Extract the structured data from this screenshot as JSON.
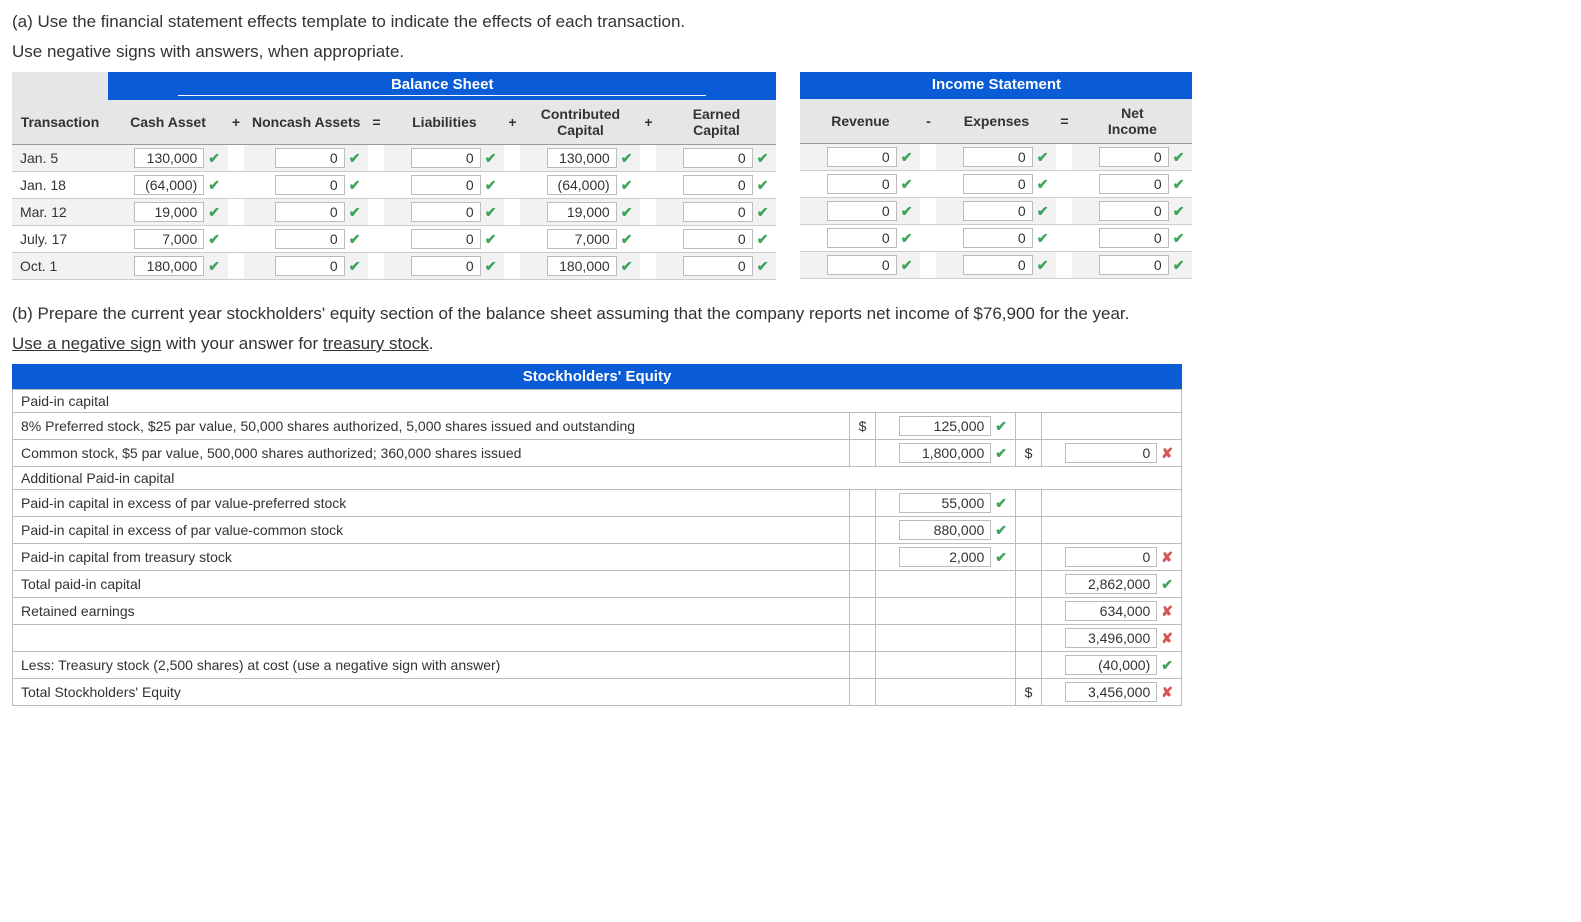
{
  "partA": {
    "prompt": "(a) Use the financial statement effects template to indicate the effects of each transaction.",
    "subprompt": "Use negative signs with answers, when appropriate.",
    "balanceSheetTitle": "Balance Sheet",
    "incomeStatementTitle": "Income Statement",
    "headers": {
      "transaction": "Transaction",
      "cash": "Cash Asset",
      "noncash": "Noncash Assets",
      "liab": "Liabilities",
      "contrib_top": "Contributed",
      "contrib_bot": "Capital",
      "earned_top": "Earned",
      "earned_bot": "Capital",
      "rev": "Revenue",
      "exp": "Expenses",
      "net_top": "Net",
      "net_bot": "Income"
    },
    "rows": [
      {
        "date": "Jan. 5",
        "cash": "130,000",
        "noncash": "0",
        "liab": "0",
        "contrib": "130,000",
        "earned": "0",
        "rev": "0",
        "exp": "0",
        "net": "0"
      },
      {
        "date": "Jan. 18",
        "cash": "(64,000)",
        "noncash": "0",
        "liab": "0",
        "contrib": "(64,000)",
        "earned": "0",
        "rev": "0",
        "exp": "0",
        "net": "0"
      },
      {
        "date": "Mar. 12",
        "cash": "19,000",
        "noncash": "0",
        "liab": "0",
        "contrib": "19,000",
        "earned": "0",
        "rev": "0",
        "exp": "0",
        "net": "0"
      },
      {
        "date": "July. 17",
        "cash": "7,000",
        "noncash": "0",
        "liab": "0",
        "contrib": "7,000",
        "earned": "0",
        "rev": "0",
        "exp": "0",
        "net": "0"
      },
      {
        "date": "Oct. 1",
        "cash": "180,000",
        "noncash": "0",
        "liab": "0",
        "contrib": "180,000",
        "earned": "0",
        "rev": "0",
        "exp": "0",
        "net": "0"
      }
    ]
  },
  "partB": {
    "prompt_pre": "(b) Prepare the current year stockholders' equity section of the balance sheet assuming that the company reports net income of $76,900 for the year.",
    "prompt_hint_a": "Use a negative sign",
    "prompt_hint_mid": " with your answer for ",
    "prompt_hint_b": "treasury stock",
    "title": "Stockholders' Equity",
    "rows": {
      "pic": "Paid-in capital",
      "pref": "8% Preferred stock, $25 par value, 50,000 shares authorized, 5,000 shares issued and outstanding",
      "common": "Common stock, $5 par value, 500,000 shares authorized; 360,000 shares issued",
      "apic": "Additional Paid-in capital",
      "pic_pref": "Paid-in capital in excess of par value-preferred stock",
      "pic_com": "Paid-in capital in excess of par value-common stock",
      "pic_ts": "Paid-in capital from treasury stock",
      "tot_pic": "Total paid-in capital",
      "re": "Retained earnings",
      "less_ts": "Less: Treasury stock (2,500 shares) at cost (use a negative sign with answer)",
      "tot_se": "Total Stockholders' Equity"
    },
    "vals": {
      "pref": "125,000",
      "common": "1,800,000",
      "common_sum": "0",
      "pic_pref": "55,000",
      "pic_com": "880,000",
      "pic_ts": "2,000",
      "pic_ts_sum": "0",
      "tot_pic": "2,862,000",
      "re": "634,000",
      "sub": "3,496,000",
      "less_ts": "(40,000)",
      "tot_se": "3,456,000"
    }
  },
  "marks": {
    "check": "✔",
    "cross": "✘"
  }
}
